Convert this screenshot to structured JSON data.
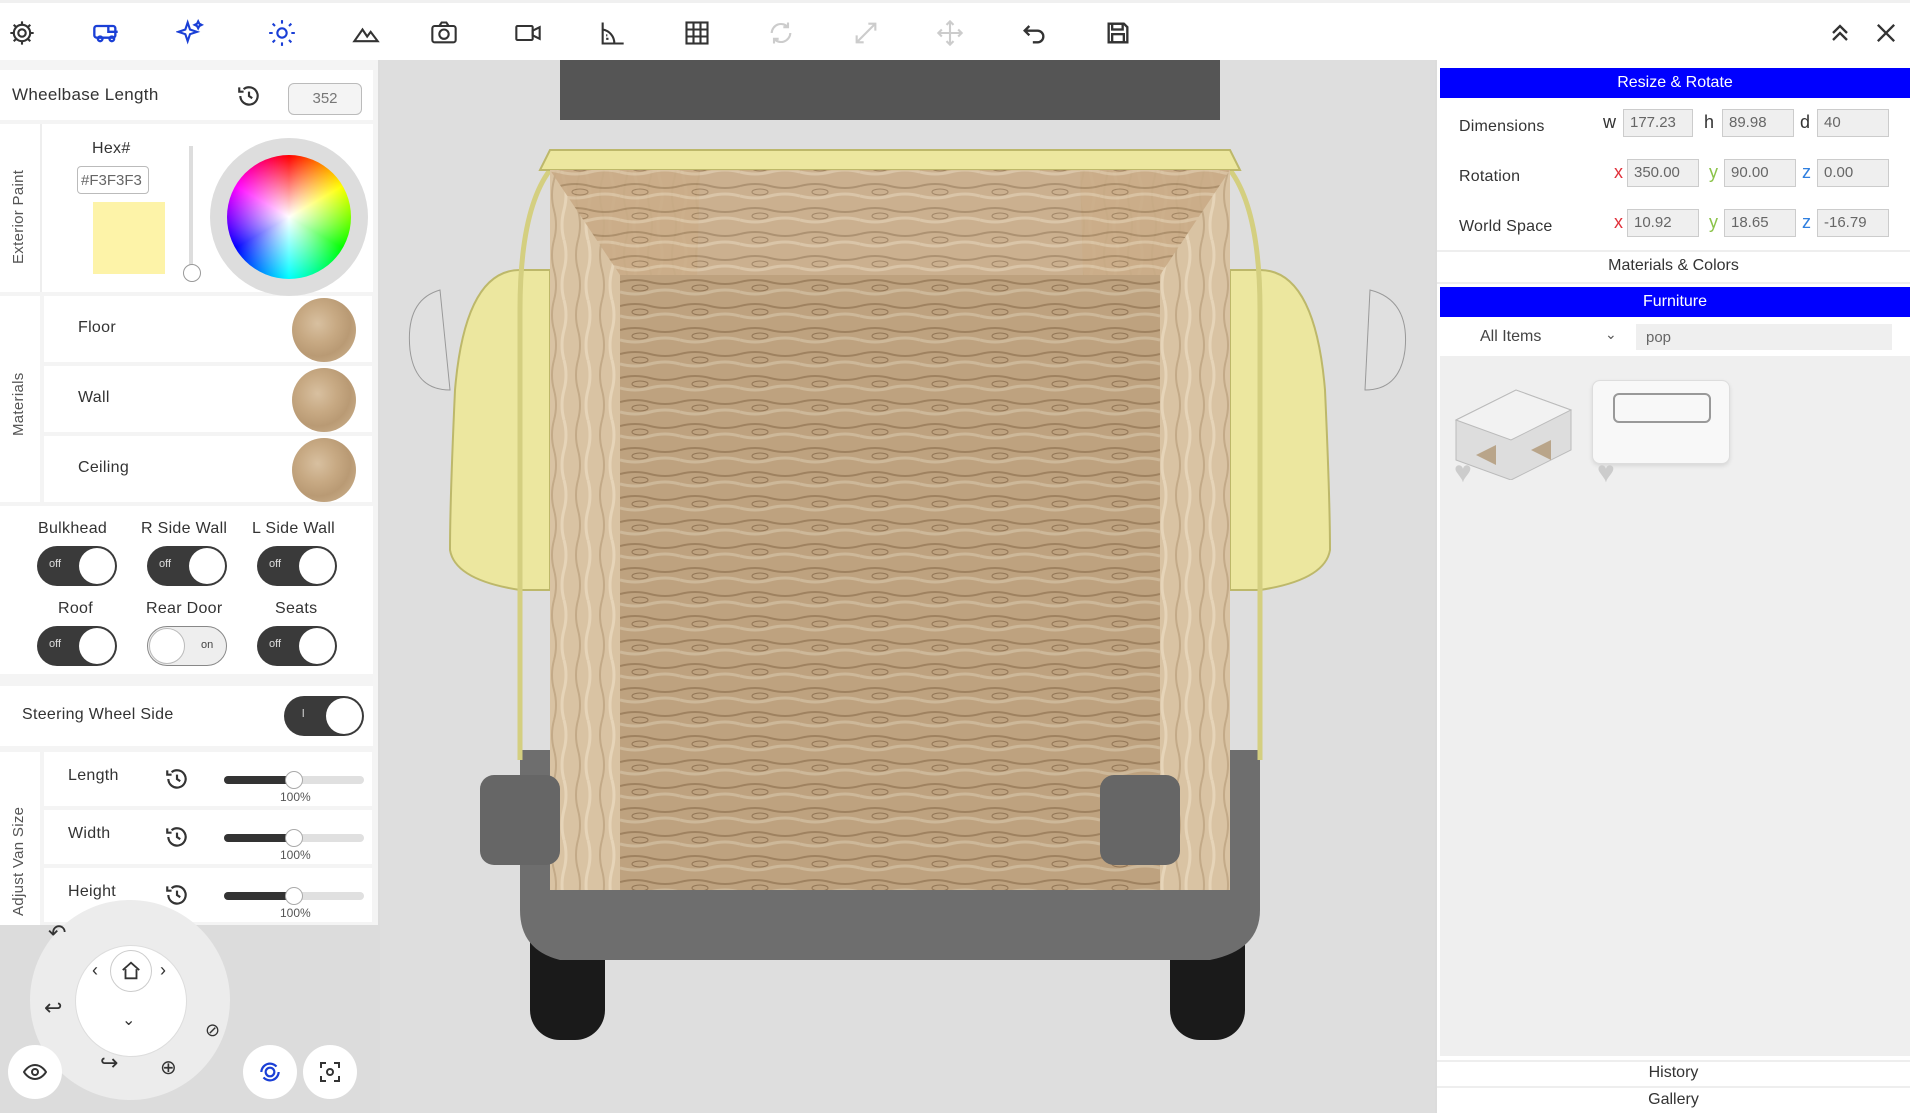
{
  "toolbar": {
    "icons": [
      "gear-icon",
      "van-icon",
      "sparkle-icon",
      "sun-icon",
      "terrain-icon",
      "camera-icon",
      "video-icon",
      "ruler-angle-icon",
      "grid-icon",
      "rotate-icon",
      "resize-icon",
      "move-icon",
      "undo-icon",
      "save-icon",
      "collapse-up-icon",
      "close-icon"
    ]
  },
  "wheelbase": {
    "label": "Wheelbase Length",
    "value": "352"
  },
  "exterior_paint": {
    "section_label": "Exterior Paint",
    "hex_label": "Hex#",
    "hex_value": "#F3F3F3",
    "swatch_color": "#fdf3a8"
  },
  "materials": {
    "section_label": "Materials",
    "items": [
      {
        "label": "Floor"
      },
      {
        "label": "Wall"
      },
      {
        "label": "Ceiling"
      }
    ]
  },
  "toggles": [
    {
      "label": "Bulkhead",
      "state": "off"
    },
    {
      "label": "R Side Wall",
      "state": "off"
    },
    {
      "label": "L Side Wall",
      "state": "off"
    },
    {
      "label": "Roof",
      "state": "off"
    },
    {
      "label": "Rear Door",
      "state": "on"
    },
    {
      "label": "Seats",
      "state": "off"
    }
  ],
  "steering": {
    "label": "Steering Wheel Side",
    "toggle_text": "l"
  },
  "van_size": {
    "section_label": "Adjust Van Size",
    "items": [
      {
        "label": "Length",
        "percent": "100%",
        "fraction": 0.5
      },
      {
        "label": "Width",
        "percent": "100%",
        "fraction": 0.5
      },
      {
        "label": "Height",
        "percent": "100%",
        "fraction": 0.5
      }
    ]
  },
  "resize_rotate": {
    "title": "Resize & Rotate",
    "dimensions": {
      "label": "Dimensions",
      "w_axis": "w",
      "h_axis": "h",
      "d_axis": "d",
      "w": "177.23",
      "h": "89.98",
      "d": "40"
    },
    "rotation": {
      "label": "Rotation",
      "x": "350.00",
      "y": "90.00",
      "z": "0.00"
    },
    "world_space": {
      "label": "World Space",
      "x": "10.92",
      "y": "18.65",
      "z": "-16.79"
    },
    "axis_labels": {
      "x": "x",
      "y": "y",
      "z": "z"
    },
    "materials_colors": "Materials & Colors"
  },
  "furniture": {
    "title": "Furniture",
    "filter": "All Items",
    "search_value": "pop"
  },
  "footer": {
    "history": "History",
    "gallery": "Gallery"
  },
  "colors": {
    "accent_blue": "#0000ff",
    "toolbar_blue": "#1a3fd6",
    "van_yellow": "#e8e39a"
  }
}
